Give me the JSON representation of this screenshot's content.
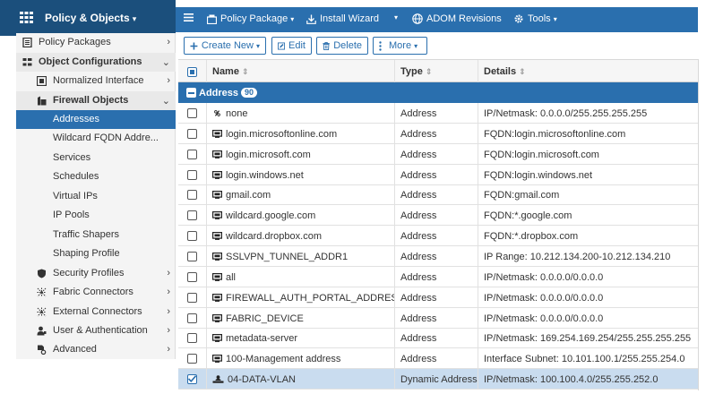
{
  "brand": {
    "title": "Policy & Objects",
    "caret": "▾"
  },
  "toolbar": {
    "menu_icon": "hamburger-icon",
    "policy_package": "Policy Package",
    "install_wizard": "Install Wizard",
    "adom_revisions": "ADOM Revisions",
    "tools": "Tools",
    "caret": "▾"
  },
  "sidebar": {
    "items": [
      {
        "label": "Policy Packages",
        "icon": "package-icon",
        "chevron": "›"
      },
      {
        "label": "Object Configurations",
        "icon": "objects-icon",
        "chevron": "⌄"
      },
      {
        "label": "Normalized Interface",
        "icon": "interface-icon",
        "chevron": "›"
      },
      {
        "label": "Firewall Objects",
        "icon": "firewall-icon",
        "chevron": "⌄"
      },
      {
        "label": "Addresses"
      },
      {
        "label": "Wildcard FQDN Addre..."
      },
      {
        "label": "Services"
      },
      {
        "label": "Schedules"
      },
      {
        "label": "Virtual IPs"
      },
      {
        "label": "IP Pools"
      },
      {
        "label": "Traffic Shapers"
      },
      {
        "label": "Shaping Profile"
      },
      {
        "label": "Security Profiles",
        "icon": "shield-icon",
        "chevron": "›"
      },
      {
        "label": "Fabric Connectors",
        "icon": "fabric-icon",
        "chevron": "›"
      },
      {
        "label": "External Connectors",
        "icon": "connector-icon",
        "chevron": "›"
      },
      {
        "label": "User & Authentication",
        "icon": "user-icon",
        "chevron": "›"
      },
      {
        "label": "Advanced",
        "icon": "advanced-icon",
        "chevron": "›"
      }
    ]
  },
  "actions": {
    "create_new": "Create New",
    "edit": "Edit",
    "delete": "Delete",
    "more": "More"
  },
  "table": {
    "headers": {
      "name": "Name",
      "type": "Type",
      "details": "Details"
    },
    "sort_glyph": "⇕",
    "group": {
      "label": "Address",
      "count": "90"
    },
    "rows": [
      {
        "name": "none",
        "type": "Address",
        "details": "IP/Netmask: 0.0.0.0/255.255.255.255",
        "icon": "address-none-icon"
      },
      {
        "name": "login.microsoftonline.com",
        "type": "Address",
        "details": "FQDN:login.microsoftonline.com",
        "icon": "address-icon"
      },
      {
        "name": "login.microsoft.com",
        "type": "Address",
        "details": "FQDN:login.microsoft.com",
        "icon": "address-icon"
      },
      {
        "name": "login.windows.net",
        "type": "Address",
        "details": "FQDN:login.windows.net",
        "icon": "address-icon"
      },
      {
        "name": "gmail.com",
        "type": "Address",
        "details": "FQDN:gmail.com",
        "icon": "address-icon"
      },
      {
        "name": "wildcard.google.com",
        "type": "Address",
        "details": "FQDN:*.google.com",
        "icon": "address-icon"
      },
      {
        "name": "wildcard.dropbox.com",
        "type": "Address",
        "details": "FQDN:*.dropbox.com",
        "icon": "address-icon"
      },
      {
        "name": "SSLVPN_TUNNEL_ADDR1",
        "type": "Address",
        "details": "IP Range: 10.212.134.200-10.212.134.210",
        "icon": "address-icon"
      },
      {
        "name": "all",
        "type": "Address",
        "details": "IP/Netmask: 0.0.0.0/0.0.0.0",
        "icon": "address-icon"
      },
      {
        "name": "FIREWALL_AUTH_PORTAL_ADDRESS",
        "type": "Address",
        "details": "IP/Netmask: 0.0.0.0/0.0.0.0",
        "icon": "address-icon"
      },
      {
        "name": "FABRIC_DEVICE",
        "type": "Address",
        "details": "IP/Netmask: 0.0.0.0/0.0.0.0",
        "icon": "address-icon"
      },
      {
        "name": "metadata-server",
        "type": "Address",
        "details": "IP/Netmask: 169.254.169.254/255.255.255.255",
        "icon": "address-icon"
      },
      {
        "name": "100-Management address",
        "type": "Address",
        "details": "Interface Subnet: 10.101.100.1/255.255.254.0",
        "icon": "address-icon"
      },
      {
        "name": "04-DATA-VLAN",
        "type": "Dynamic Address",
        "details": "IP/Netmask: 100.100.4.0/255.255.252.0",
        "icon": "dynamic-address-icon",
        "checked": true
      }
    ]
  },
  "colors": {
    "brand": "#1b4f7c",
    "accent": "#2a6fae",
    "selected_row": "#c9dcef"
  }
}
